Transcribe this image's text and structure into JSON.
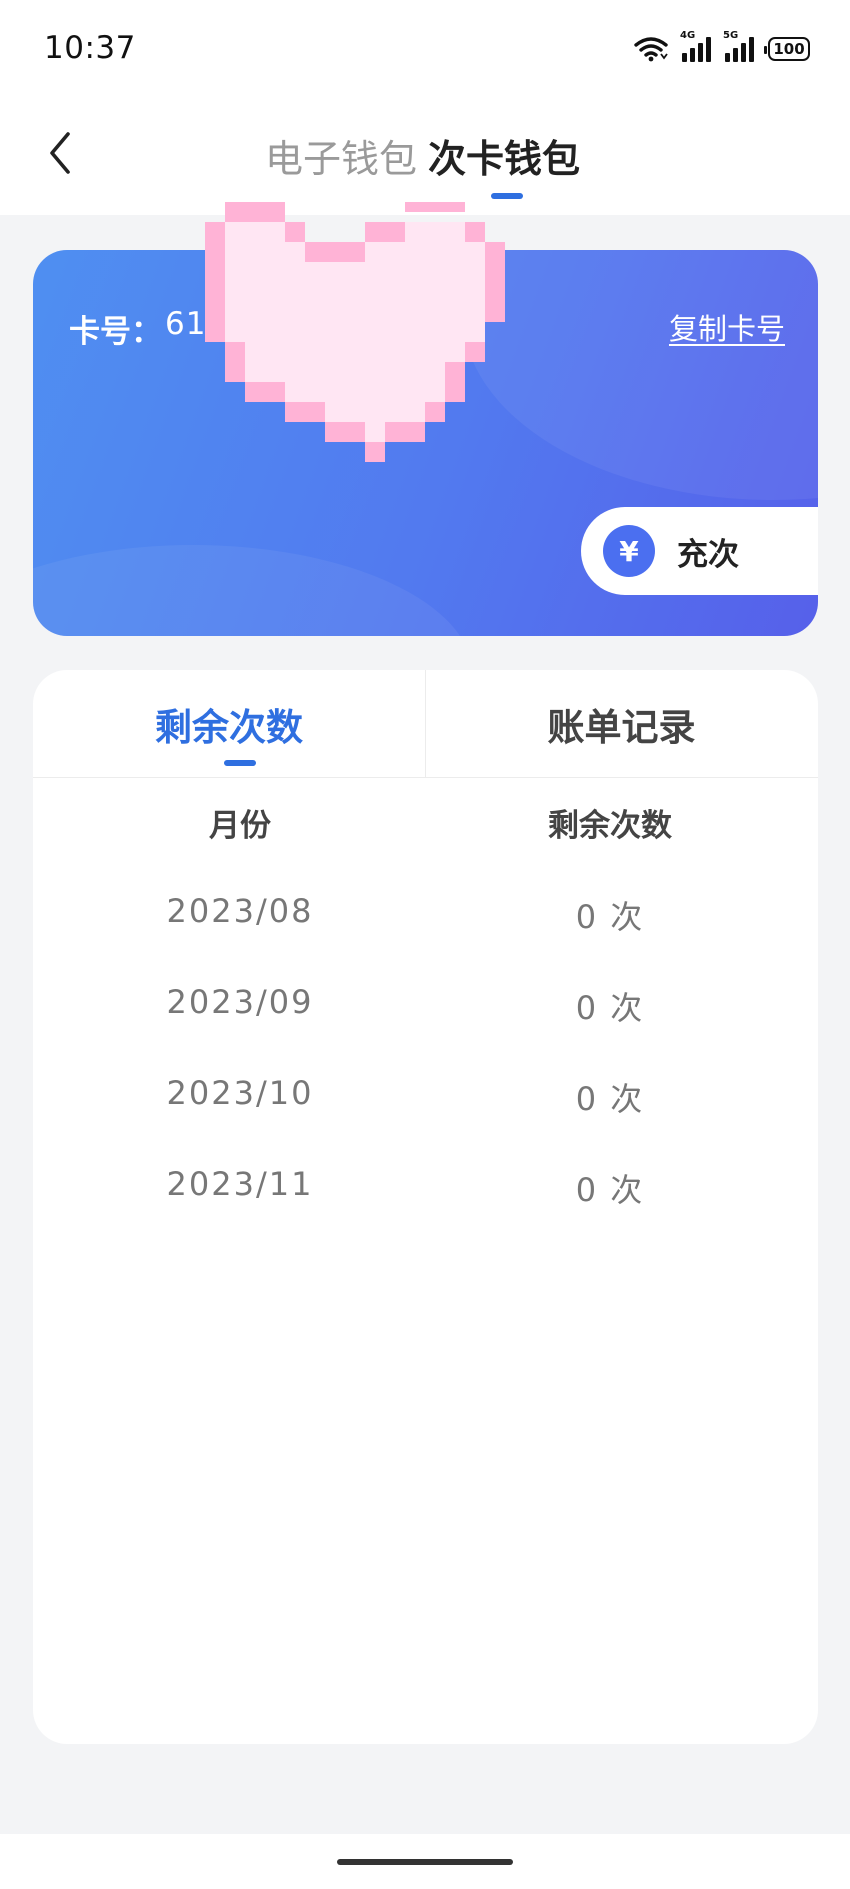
{
  "status_bar": {
    "time": "10:37",
    "network_1": "4G",
    "network_2": "5G",
    "battery": "100"
  },
  "header": {
    "tabs": [
      {
        "label": "电子钱包",
        "active": false
      },
      {
        "label": "次卡钱包",
        "active": true
      }
    ]
  },
  "card": {
    "number_label": "卡号：",
    "number_visible": "61",
    "copy_label": "复制卡号",
    "recharge_icon": "¥",
    "recharge_label": "充次"
  },
  "panel": {
    "tabs": [
      {
        "label": "剩余次数",
        "active": true
      },
      {
        "label": "账单记录",
        "active": false
      }
    ],
    "columns": [
      "月份",
      "剩余次数"
    ],
    "rows": [
      {
        "month": "2023/08",
        "remaining": "0 次"
      },
      {
        "month": "2023/09",
        "remaining": "0 次"
      },
      {
        "month": "2023/10",
        "remaining": "0 次"
      },
      {
        "month": "2023/11",
        "remaining": "0 次"
      }
    ]
  },
  "colors": {
    "accent": "#2f6fe0",
    "card_gradient_start": "#4f8ff1",
    "card_gradient_end": "#5660ea",
    "sticker_pink": "#ffb3d6"
  }
}
